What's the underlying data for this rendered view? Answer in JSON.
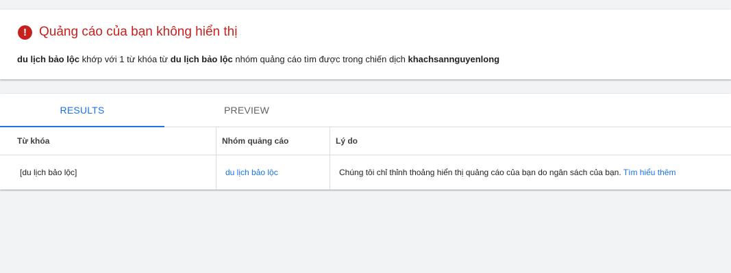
{
  "alert": {
    "icon": "error-icon",
    "icon_color": "#c5221f",
    "title": "Quảng cáo của bạn không hiển thị",
    "desc_keyword": "du lịch bảo lộc",
    "desc_text1": " khớp với 1 từ khóa từ ",
    "desc_adgroup": "du lịch bảo lộc",
    "desc_text2": " nhóm quảng cáo tìm được trong chiến dịch ",
    "desc_campaign": "khachsannguyenlong"
  },
  "tabs": {
    "results_label": "RESULTS",
    "preview_label": "PREVIEW",
    "active": "RESULTS",
    "accent_color": "#1a73e8"
  },
  "table": {
    "headers": [
      "Từ khóa",
      "Nhóm quảng cáo",
      "Lý do"
    ],
    "rows": [
      {
        "keyword": "[du lịch bảo lộc]",
        "adgroup": "du lịch bảo lộc",
        "reason": "Chúng tôi chỉ thỉnh thoảng hiển thị quảng cáo của bạn do ngân sách của bạn. ",
        "learn_more": "Tìm hiểu thêm"
      }
    ]
  }
}
